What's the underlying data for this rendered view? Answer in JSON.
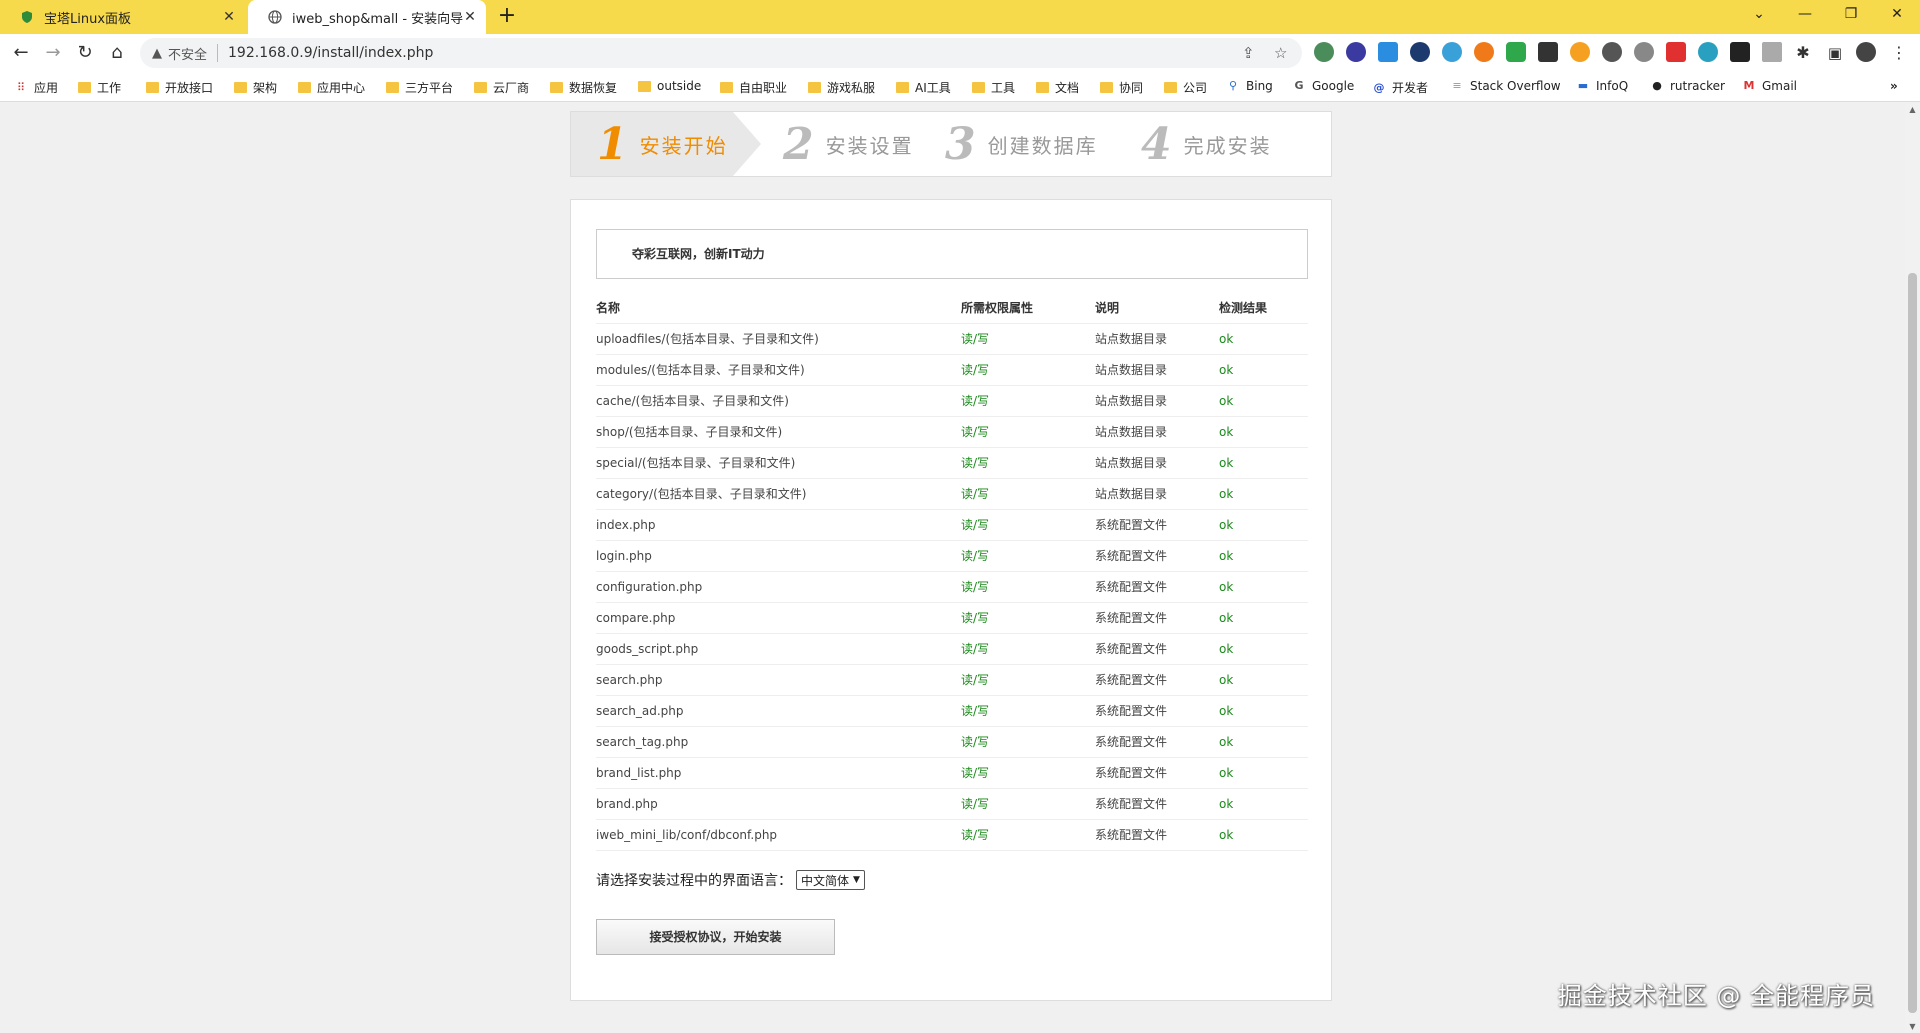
{
  "browser": {
    "tabs": [
      {
        "title": "宝塔Linux面板",
        "active": false
      },
      {
        "title": "iweb_shop&mall - 安装向导",
        "active": true
      }
    ],
    "address": {
      "security_label": "不安全",
      "url": "192.168.0.9/install/index.php"
    },
    "bookmarks": [
      {
        "label": "应用",
        "icon": "apps-grid-icon"
      },
      {
        "label": "工作",
        "icon": "folder-icon"
      },
      {
        "label": "开放接口",
        "icon": "folder-icon"
      },
      {
        "label": "架构",
        "icon": "folder-icon"
      },
      {
        "label": "应用中心",
        "icon": "folder-icon"
      },
      {
        "label": "三方平台",
        "icon": "folder-icon"
      },
      {
        "label": "云厂商",
        "icon": "folder-icon"
      },
      {
        "label": "数据恢复",
        "icon": "folder-icon"
      },
      {
        "label": "outside",
        "icon": "folder-icon"
      },
      {
        "label": "自由职业",
        "icon": "folder-icon"
      },
      {
        "label": "游戏私服",
        "icon": "folder-icon"
      },
      {
        "label": "AI工具",
        "icon": "folder-icon"
      },
      {
        "label": "工具",
        "icon": "folder-icon"
      },
      {
        "label": "文档",
        "icon": "folder-icon"
      },
      {
        "label": "协同",
        "icon": "folder-icon"
      },
      {
        "label": "公司",
        "icon": "folder-icon"
      },
      {
        "label": "Bing",
        "icon": "search-icon"
      },
      {
        "label": "Google",
        "icon": "google-icon"
      },
      {
        "label": "开发者",
        "icon": "dev-icon"
      },
      {
        "label": "Stack Overflow",
        "icon": "stackoverflow-icon"
      },
      {
        "label": "InfoQ",
        "icon": "infoq-icon"
      },
      {
        "label": "rutracker",
        "icon": "rutracker-icon"
      },
      {
        "label": "Gmail",
        "icon": "gmail-icon"
      }
    ],
    "more_bookmarks": "»"
  },
  "install": {
    "steps": [
      {
        "num": "1",
        "label": "安装开始",
        "active": true
      },
      {
        "num": "2",
        "label": "安装设置",
        "active": false
      },
      {
        "num": "3",
        "label": "创建数据库",
        "active": false
      },
      {
        "num": "4",
        "label": "完成安装",
        "active": false
      }
    ],
    "slogan": "夺彩互联网，创新IT动力",
    "table": {
      "headers": [
        "名称",
        "所需权限属性",
        "说明",
        "检测结果"
      ],
      "rows": [
        [
          "uploadfiles/(包括本目录、子目录和文件)",
          "读/写",
          "站点数据目录",
          "ok"
        ],
        [
          "modules/(包括本目录、子目录和文件)",
          "读/写",
          "站点数据目录",
          "ok"
        ],
        [
          "cache/(包括本目录、子目录和文件)",
          "读/写",
          "站点数据目录",
          "ok"
        ],
        [
          "shop/(包括本目录、子目录和文件)",
          "读/写",
          "站点数据目录",
          "ok"
        ],
        [
          "special/(包括本目录、子目录和文件)",
          "读/写",
          "站点数据目录",
          "ok"
        ],
        [
          "category/(包括本目录、子目录和文件)",
          "读/写",
          "站点数据目录",
          "ok"
        ],
        [
          "index.php",
          "读/写",
          "系统配置文件",
          "ok"
        ],
        [
          "login.php",
          "读/写",
          "系统配置文件",
          "ok"
        ],
        [
          "configuration.php",
          "读/写",
          "系统配置文件",
          "ok"
        ],
        [
          "compare.php",
          "读/写",
          "系统配置文件",
          "ok"
        ],
        [
          "goods_script.php",
          "读/写",
          "系统配置文件",
          "ok"
        ],
        [
          "search.php",
          "读/写",
          "系统配置文件",
          "ok"
        ],
        [
          "search_ad.php",
          "读/写",
          "系统配置文件",
          "ok"
        ],
        [
          "search_tag.php",
          "读/写",
          "系统配置文件",
          "ok"
        ],
        [
          "brand_list.php",
          "读/写",
          "系统配置文件",
          "ok"
        ],
        [
          "brand.php",
          "读/写",
          "系统配置文件",
          "ok"
        ],
        [
          "iweb_mini_lib/conf/dbconf.php",
          "读/写",
          "系统配置文件",
          "ok"
        ]
      ]
    },
    "language_prompt": "请选择安装过程中的界面语言：",
    "language_selected": "中文简体",
    "start_button": "接受授权协议，开始安装"
  },
  "watermark": "掘金技术社区 @ 全能程序员",
  "colors": {
    "accent": "#f08c00",
    "ok": "#1a8a1a",
    "tabbar": "#f7d94c"
  }
}
